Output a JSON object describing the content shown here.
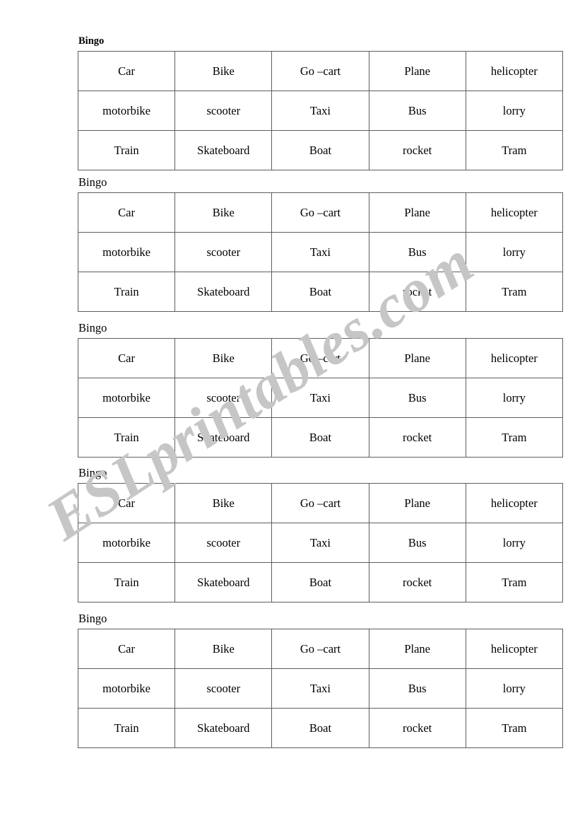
{
  "document": {
    "title": "Bingo",
    "page_background": "#ffffff",
    "text_color": "#000000",
    "table_border_color": "#5e5e5e"
  },
  "watermark": {
    "text": "ESLprintables.com",
    "color": "#c6c6c6",
    "rotation_deg": -33
  },
  "labels": {
    "bingo_1": "Bingo",
    "bingo_2": "Bingo",
    "bingo_3": "Bingo",
    "bingo_4": "Bingo",
    "bingo_5": "Bingo"
  },
  "cards": [
    {
      "id": "card-1",
      "label": "Bingo",
      "label_bold": true,
      "rows": [
        [
          "Car",
          "Bike",
          "Go –cart",
          "Plane",
          "helicopter"
        ],
        [
          "motorbike",
          "scooter",
          "Taxi",
          "Bus",
          "lorry"
        ],
        [
          "Train",
          "Skateboard",
          "Boat",
          "rocket",
          "Tram"
        ]
      ]
    },
    {
      "id": "card-2",
      "label": "Bingo",
      "label_bold": false,
      "rows": [
        [
          "Car",
          "Bike",
          "Go –cart",
          "Plane",
          "helicopter"
        ],
        [
          "motorbike",
          "scooter",
          "Taxi",
          "Bus",
          "lorry"
        ],
        [
          "Train",
          "Skateboard",
          "Boat",
          "rocket",
          "Tram"
        ]
      ]
    },
    {
      "id": "card-3",
      "label": "Bingo",
      "label_bold": false,
      "rows": [
        [
          "Car",
          "Bike",
          "Go –cart",
          "Plane",
          "helicopter"
        ],
        [
          "motorbike",
          "scooter",
          "Taxi",
          "Bus",
          "lorry"
        ],
        [
          "Train",
          "Skateboard",
          "Boat",
          "rocket",
          "Tram"
        ]
      ]
    },
    {
      "id": "card-4",
      "label": "Bingo",
      "label_bold": false,
      "rows": [
        [
          "Car",
          "Bike",
          "Go –cart",
          "Plane",
          "helicopter"
        ],
        [
          "motorbike",
          "scooter",
          "Taxi",
          "Bus",
          "lorry"
        ],
        [
          "Train",
          "Skateboard",
          "Boat",
          "rocket",
          "Tram"
        ]
      ]
    },
    {
      "id": "card-5",
      "label": "Bingo",
      "label_bold": false,
      "rows": [
        [
          "Car",
          "Bike",
          "Go –cart",
          "Plane",
          "helicopter"
        ],
        [
          "motorbike",
          "scooter",
          "Taxi",
          "Bus",
          "lorry"
        ],
        [
          "Train",
          "Skateboard",
          "Boat",
          "rocket",
          "Tram"
        ]
      ]
    }
  ]
}
